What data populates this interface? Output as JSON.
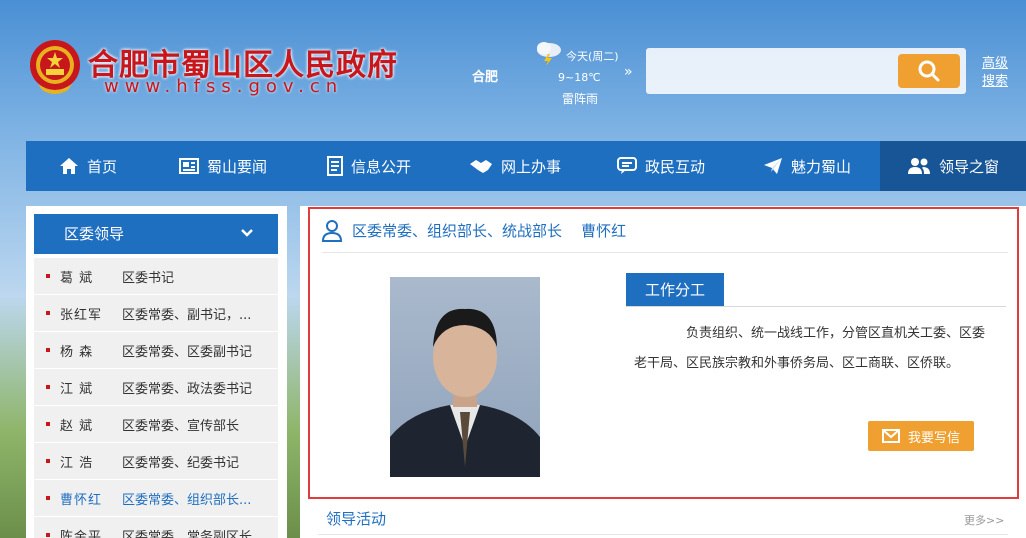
{
  "header": {
    "title": "合肥市蜀山区人民政府",
    "domain": "www.hfss.gov.cn",
    "city": "合肥",
    "weather_day": "今天(周二)",
    "weather_temp": "9~18℃",
    "weather_cond": "雷阵雨",
    "weather_icon": "thunderstorm-icon",
    "search_placeholder": "",
    "advanced_search": "高级搜索"
  },
  "nav": {
    "items": [
      {
        "label": "首页",
        "icon": "home-icon"
      },
      {
        "label": "蜀山要闻",
        "icon": "newspaper-icon"
      },
      {
        "label": "信息公开",
        "icon": "document-icon"
      },
      {
        "label": "网上办事",
        "icon": "handshake-icon"
      },
      {
        "label": "政民互动",
        "icon": "chat-icon"
      },
      {
        "label": "魅力蜀山",
        "icon": "paper-plane-icon"
      },
      {
        "label": "领导之窗",
        "icon": "users-icon"
      }
    ],
    "active_index": 6
  },
  "sidebar": {
    "heading": "区委领导",
    "leaders": [
      {
        "name": "葛  斌",
        "title": "区委书记"
      },
      {
        "name": "张红军",
        "title": "区委常委、副书记，..."
      },
      {
        "name": "杨  森",
        "title": "区委常委、区委副书记"
      },
      {
        "name": "江  斌",
        "title": "区委常委、政法委书记"
      },
      {
        "name": "赵  斌",
        "title": "区委常委、宣传部长"
      },
      {
        "name": "江  浩",
        "title": "区委常委、纪委书记"
      },
      {
        "name": "曹怀红",
        "title": "区委常委、组织部长..."
      },
      {
        "name": "陈金平",
        "title": "区委常委、常务副区长"
      }
    ],
    "current_index": 6
  },
  "profile": {
    "heading": "区委常委、组织部长、统战部长    曹怀红",
    "duty_tab": "工作分工",
    "duty_text": "负责组织、统一战线工作，分管区直机关工委、区委老干局、区民族宗教和外事侨务局、区工商联、区侨联。",
    "write_button": "我要写信"
  },
  "activity": {
    "title": "领导活动",
    "more": "更多>>"
  },
  "colors": {
    "primary": "#1f6fc1",
    "accent": "#f0a030",
    "title_red": "#c8161d",
    "highlight_border": "#e03c3c"
  }
}
